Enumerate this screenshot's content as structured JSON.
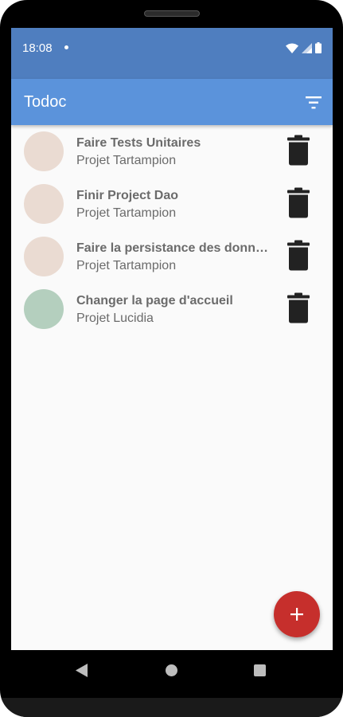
{
  "status_bar": {
    "time": "18:08"
  },
  "app_bar": {
    "title": "Todoc"
  },
  "tasks": [
    {
      "name": "Faire Tests Unitaires",
      "project": "Projet Tartampion",
      "project_color": "#EADBD2"
    },
    {
      "name": "Finir Project Dao",
      "project": "Projet Tartampion",
      "project_color": "#EADBD2"
    },
    {
      "name": "Faire la persistance des donn…",
      "project": "Projet Tartampion",
      "project_color": "#EADBD2"
    },
    {
      "name": "Changer la page d'accueil",
      "project": "Projet Lucidia",
      "project_color": "#B4CFBE"
    }
  ],
  "icons": {
    "filter": "filter-icon",
    "delete": "trash-icon",
    "add": "plus-icon",
    "nav_back": "back-triangle-icon",
    "nav_home": "home-circle-icon",
    "nav_recent": "recents-square-icon"
  },
  "colors": {
    "status_bar": "#4F7EBF",
    "app_bar": "#5B93DB",
    "fab": "#C62F2C",
    "background": "#FAFAFA"
  }
}
